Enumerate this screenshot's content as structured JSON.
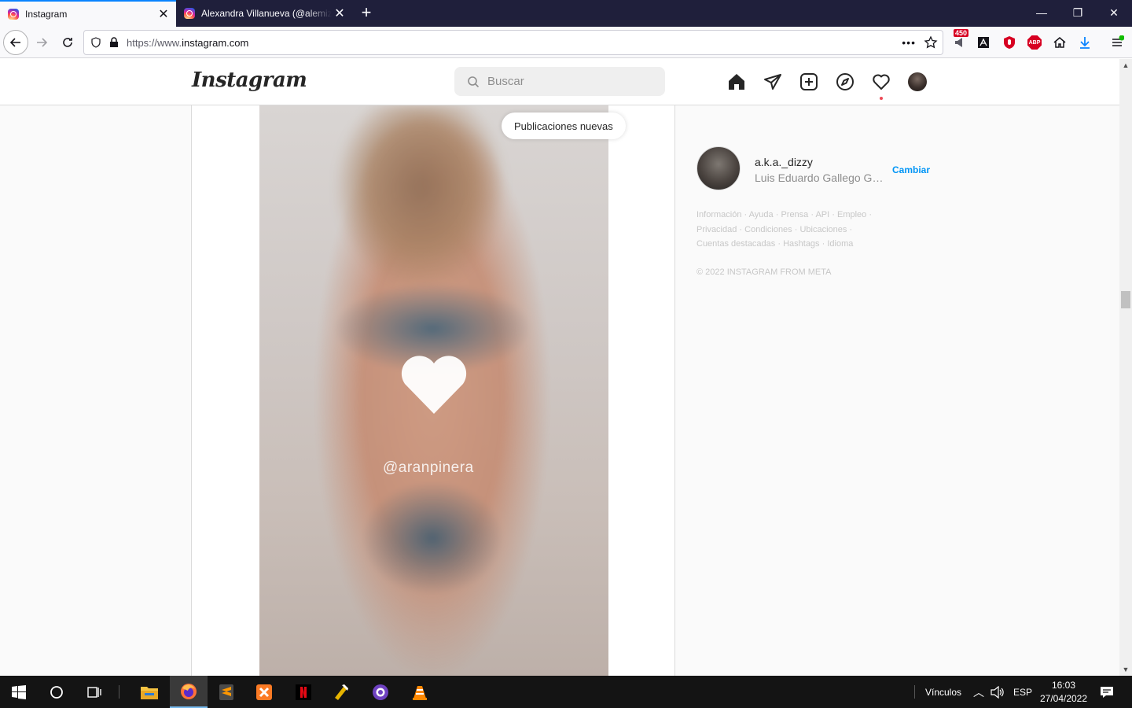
{
  "browser": {
    "tabs": [
      {
        "title": "Instagram",
        "active": true
      },
      {
        "title": "Alexandra Villanueva (@alemiz...",
        "active": false
      }
    ],
    "url_prefix": "https://www.",
    "url_domain": "instagram.com",
    "extensions": {
      "badge_count": "450",
      "abp_label": "ABP"
    }
  },
  "instagram": {
    "logo": "Instagram",
    "search": {
      "placeholder": "Buscar"
    },
    "nav_icons": [
      "home-icon",
      "direct-message-icon",
      "new-post-icon",
      "explore-icon",
      "activity-heart-icon",
      "profile-avatar"
    ],
    "new_posts_pill": "Publicaciones nuevas",
    "post": {
      "watermark": "@aranpinera"
    },
    "sidebar": {
      "username": "a.k.a._dizzy",
      "full_name": "Luis Eduardo Gallego Gar...",
      "switch_label": "Cambiar",
      "footer_links": [
        "Información",
        "Ayuda",
        "Prensa",
        "API",
        "Empleo",
        "Privacidad",
        "Condiciones",
        "Ubicaciones",
        "Cuentas destacadas",
        "Hashtags",
        "Idioma"
      ],
      "copyright": "© 2022 INSTAGRAM FROM META"
    }
  },
  "taskbar": {
    "links_label": "Vínculos",
    "language": "ESP",
    "time": "16:03",
    "date": "27/04/2022"
  }
}
